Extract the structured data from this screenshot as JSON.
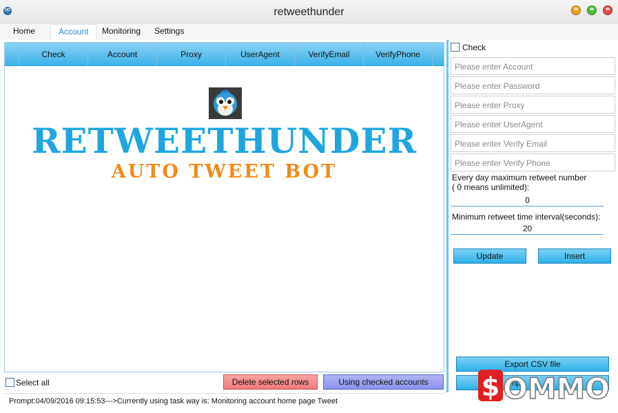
{
  "window": {
    "title": "retweethunder",
    "colors": {
      "close": "#e14a4a",
      "maximize": "#4fbf3a",
      "minimize": "#f0a020"
    }
  },
  "menu": {
    "items": [
      "Home",
      "Account",
      "Monitoring",
      "Settings"
    ],
    "active": "Account"
  },
  "grid": {
    "columns": [
      "Check",
      "Account",
      "Proxy",
      "UserAgent",
      "VerifyEmail",
      "VerifyPhone"
    ]
  },
  "logo": {
    "main": "RETWEETHUNDER",
    "sub": "AUTO TWEET BOT",
    "colors": {
      "main": "#1ea6e0",
      "sub": "#f28a19"
    }
  },
  "bottom": {
    "select_all": "Select all",
    "delete_rows": "Delete selected rows",
    "use_checked": "Using checked accounts"
  },
  "status": {
    "text": "Prompt:04/09/2016 09:15:53--->Currently using task way is: Monitoring account home page Tweet"
  },
  "form": {
    "check_label": "Check",
    "placeholders": {
      "account": "Please enter Account",
      "password": "Please enter Password",
      "proxy": "Please enter Proxy",
      "useragent": "Please enter UserAgent",
      "email": "Please enter Verify Email",
      "phone": "Please enter Verify Phone"
    },
    "max_retweet_label_1": "Every day maximum retweet number",
    "max_retweet_label_2": "( 0 means unlimited):",
    "max_retweet_value": "0",
    "interval_label": "Minimum retweet time interval(seconds):",
    "interval_value": "20",
    "update": "Update",
    "insert": "Insert",
    "export_csv": "Export CSV file",
    "import_partial": "mp"
  },
  "watermark": {
    "text": "$OMMO"
  }
}
